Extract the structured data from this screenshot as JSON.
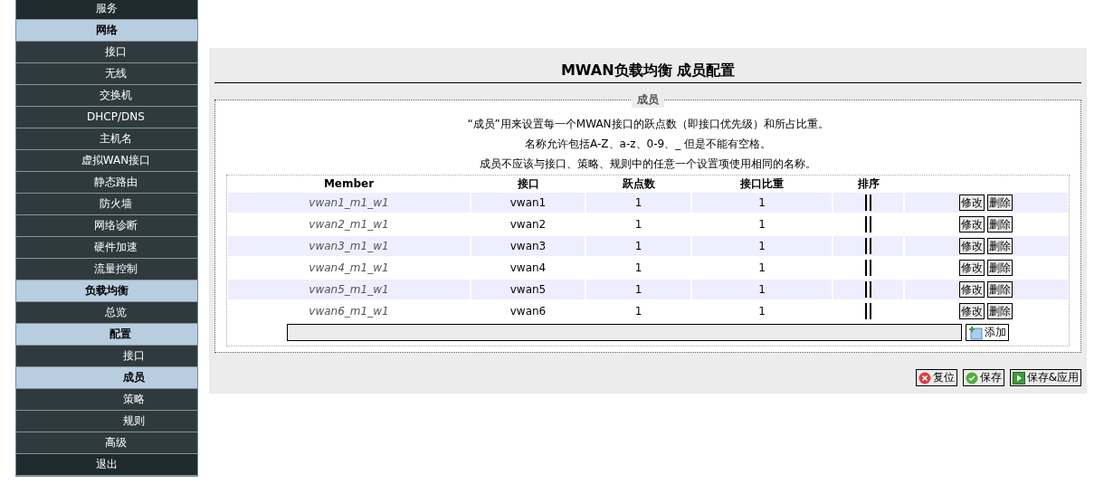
{
  "sidebar": {
    "items": [
      {
        "label": "服务",
        "kind": "item",
        "selected": false
      },
      {
        "label": "网络",
        "kind": "header",
        "children": [
          {
            "label": "接口",
            "kind": "item",
            "selected": false
          },
          {
            "label": "无线",
            "kind": "item",
            "selected": false
          },
          {
            "label": "交换机",
            "kind": "item",
            "selected": false
          },
          {
            "label": "DHCP/DNS",
            "kind": "item",
            "selected": false
          },
          {
            "label": "主机名",
            "kind": "item",
            "selected": false
          },
          {
            "label": "虚拟WAN接口",
            "kind": "item",
            "selected": false
          },
          {
            "label": "静态路由",
            "kind": "item",
            "selected": false
          },
          {
            "label": "防火墙",
            "kind": "item",
            "selected": false
          },
          {
            "label": "网络诊断",
            "kind": "item",
            "selected": false
          },
          {
            "label": "硬件加速",
            "kind": "item",
            "selected": false
          },
          {
            "label": "流量控制",
            "kind": "item",
            "selected": false
          }
        ]
      },
      {
        "label": "负载均衡",
        "kind": "header",
        "children": [
          {
            "label": "总览",
            "kind": "item",
            "selected": false
          },
          {
            "label": "配置",
            "kind": "header",
            "children": [
              {
                "label": "接口",
                "kind": "item",
                "selected": false
              },
              {
                "label": "成员",
                "kind": "item",
                "selected": true
              },
              {
                "label": "策略",
                "kind": "item",
                "selected": false
              },
              {
                "label": "规则",
                "kind": "item",
                "selected": false
              }
            ]
          },
          {
            "label": "高级",
            "kind": "item",
            "selected": false
          }
        ]
      },
      {
        "label": "退出",
        "kind": "item",
        "selected": false
      }
    ]
  },
  "page": {
    "title": "MWAN负载均衡 成员配置",
    "section": {
      "legend": "成员",
      "description": [
        "“成员”用来设置每一个MWAN接口的跃点数（即接口优先级）和所占比重。",
        "名称允许包括A-Z、a-z、0-9、_ 但是不能有空格。",
        "成员不应该与接口、策略、规则中的任意一个设置项使用相同的名称。"
      ],
      "table": {
        "columns": [
          "Member",
          "接口",
          "跃点数",
          "接口比重",
          "排序"
        ],
        "rows": [
          {
            "member": "vwan1_m1_w1",
            "interface": "vwan1",
            "metric": "1",
            "weight": "1",
            "edit": "修改",
            "delete": "删除"
          },
          {
            "member": "vwan2_m1_w1",
            "interface": "vwan2",
            "metric": "1",
            "weight": "1",
            "edit": "修改",
            "delete": "删除"
          },
          {
            "member": "vwan3_m1_w1",
            "interface": "vwan3",
            "metric": "1",
            "weight": "1",
            "edit": "修改",
            "delete": "删除"
          },
          {
            "member": "vwan4_m1_w1",
            "interface": "vwan4",
            "metric": "1",
            "weight": "1",
            "edit": "修改",
            "delete": "删除"
          },
          {
            "member": "vwan5_m1_w1",
            "interface": "vwan5",
            "metric": "1",
            "weight": "1",
            "edit": "修改",
            "delete": "删除"
          },
          {
            "member": "vwan6_m1_w1",
            "interface": "vwan6",
            "metric": "1",
            "weight": "1",
            "edit": "修改",
            "delete": "删除"
          }
        ],
        "add_button": "添加"
      }
    },
    "buttons": [
      {
        "label": "复位",
        "kind": "reset"
      },
      {
        "label": "保存",
        "kind": "save"
      },
      {
        "label": "保存&应用",
        "kind": "apply"
      }
    ]
  }
}
